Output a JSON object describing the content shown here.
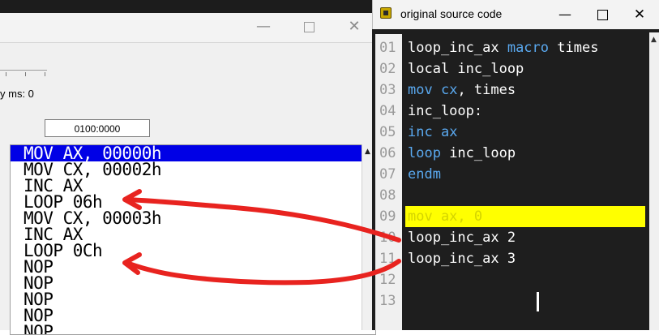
{
  "emulator": {
    "delay_label": "y ms: 0",
    "address_value": "0100:0000",
    "listing": [
      "MOV AX, 00000h",
      "MOV CX, 00002h",
      "INC AX",
      "LOOP 06h",
      "MOV CX, 00003h",
      "INC AX",
      "LOOP 0Ch",
      "NOP",
      "NOP",
      "NOP",
      "NOP",
      "NOP"
    ],
    "selected_index": 0
  },
  "source_window": {
    "title": "original source code",
    "lines": [
      {
        "n": "01",
        "segments": [
          {
            "t": "loop_inc_ax ",
            "kw": false
          },
          {
            "t": "macro",
            "kw": true
          },
          {
            "t": " times",
            "kw": false
          }
        ]
      },
      {
        "n": "02",
        "segments": [
          {
            "t": "local inc_loop",
            "kw": false
          }
        ]
      },
      {
        "n": "03",
        "segments": [
          {
            "t": "mov",
            "kw": true
          },
          {
            "t": " ",
            "kw": false
          },
          {
            "t": "cx",
            "kw": true
          },
          {
            "t": ", times",
            "kw": false
          }
        ]
      },
      {
        "n": "04",
        "segments": [
          {
            "t": "inc_loop:",
            "kw": false
          }
        ]
      },
      {
        "n": "05",
        "segments": [
          {
            "t": "inc",
            "kw": true
          },
          {
            "t": " ",
            "kw": false
          },
          {
            "t": "ax",
            "kw": true
          }
        ]
      },
      {
        "n": "06",
        "segments": [
          {
            "t": "loop",
            "kw": true
          },
          {
            "t": " inc_loop",
            "kw": false
          }
        ]
      },
      {
        "n": "07",
        "segments": [
          {
            "t": "endm",
            "kw": true
          }
        ]
      },
      {
        "n": "08",
        "segments": []
      },
      {
        "n": "09",
        "segments": [
          {
            "t": "mov ax, 0",
            "kw": false
          }
        ],
        "highlight": true
      },
      {
        "n": "10",
        "segments": [
          {
            "t": "loop_inc_ax 2",
            "kw": false
          }
        ]
      },
      {
        "n": "11",
        "segments": [
          {
            "t": "loop_inc_ax 3",
            "kw": false
          }
        ]
      },
      {
        "n": "12",
        "segments": []
      },
      {
        "n": "13",
        "segments": []
      }
    ]
  },
  "colors": {
    "selection": "#0000e6",
    "keyword": "#5aa9f0",
    "highlight": "#ffff00",
    "arrow": "#e8231f"
  },
  "icons": [
    "app-icon",
    "minimize-icon",
    "maximize-icon",
    "close-icon"
  ]
}
